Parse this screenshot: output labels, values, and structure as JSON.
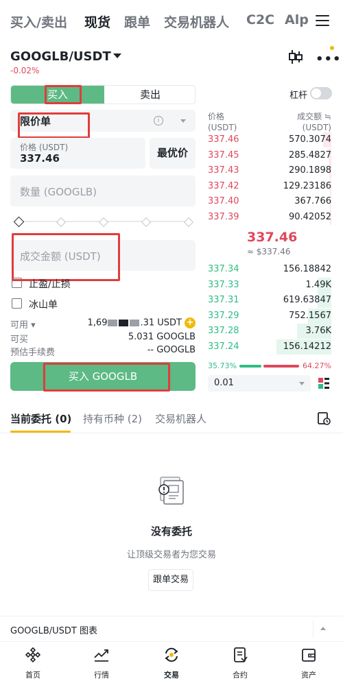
{
  "top_nav": {
    "items": [
      "买入/卖出",
      "现货",
      "跟单",
      "交易机器人",
      "C2C",
      "Alpl"
    ]
  },
  "pair": {
    "symbol": "GOOGLB/USDT",
    "change": "-0.02%"
  },
  "trade_tabs": {
    "buy": "买入",
    "sell": "卖出"
  },
  "leverage": {
    "label": "杠杆"
  },
  "order_form": {
    "order_type": "限价单",
    "price_label": "价格 (USDT)",
    "price_value": "337.46",
    "best_price": "最优价",
    "quantity_placeholder": "数量 (GOOGLB)",
    "amount_placeholder": "成交金额 (USDT)",
    "tp_sl": "止盈/止损",
    "iceberg": "冰山单",
    "available_label": "可用",
    "available_value_prefix": "1,69",
    "available_value_suffix": ".31 USDT",
    "can_buy_label": "可买",
    "can_buy_value": "5.031 GOOGLB",
    "fee_label": "预估手续费",
    "fee_value": "-- GOOGLB",
    "buy_button": "买入 GOOGLB"
  },
  "order_book": {
    "header_price": [
      "价格",
      "(USDT)"
    ],
    "header_amount": [
      "成交额 ≒",
      "(USDT)"
    ],
    "asks": [
      {
        "price": "337.46",
        "amount": "570.3074",
        "depth": 0.15
      },
      {
        "price": "337.45",
        "amount": "285.4827",
        "depth": 0.05
      },
      {
        "price": "337.43",
        "amount": "290.1898",
        "depth": 0.04
      },
      {
        "price": "337.42",
        "amount": "129.23186",
        "depth": 0.03
      },
      {
        "price": "337.40",
        "amount": "367.766",
        "depth": 0.02
      },
      {
        "price": "337.39",
        "amount": "90.42052",
        "depth": 0.02
      }
    ],
    "mid_price": "337.46",
    "mid_price_sub": "≈ $337.46",
    "bids": [
      {
        "price": "337.34",
        "amount": "156.18842",
        "depth": 0.0
      },
      {
        "price": "337.33",
        "amount": "1.49K",
        "depth": 0.25
      },
      {
        "price": "337.31",
        "amount": "619.63847",
        "depth": 0.25
      },
      {
        "price": "337.29",
        "amount": "752.1567",
        "depth": 0.43
      },
      {
        "price": "337.28",
        "amount": "3.76K",
        "depth": 0.62
      },
      {
        "price": "337.24",
        "amount": "156.14212",
        "depth": 1.0
      }
    ],
    "buy_ratio": "35.73%",
    "sell_ratio": "64.27%",
    "step": "0.01"
  },
  "bottom_tabs": [
    "当前委托 (0)",
    "持有币种 (2)",
    "交易机器人"
  ],
  "empty_state": {
    "title": "没有委托",
    "subtitle": "让顶级交易者为您交易",
    "button": "跟单交易"
  },
  "chart_bar": {
    "label": "GOOGLB/USDT 图表"
  },
  "bottom_nav": [
    "首页",
    "行情",
    "交易",
    "合约",
    "资产"
  ],
  "colors": {
    "buy_green": "#5dba85",
    "bid_text": "#2ebd85",
    "ask_red": "#e0475a",
    "accent": "#f0b90b"
  }
}
